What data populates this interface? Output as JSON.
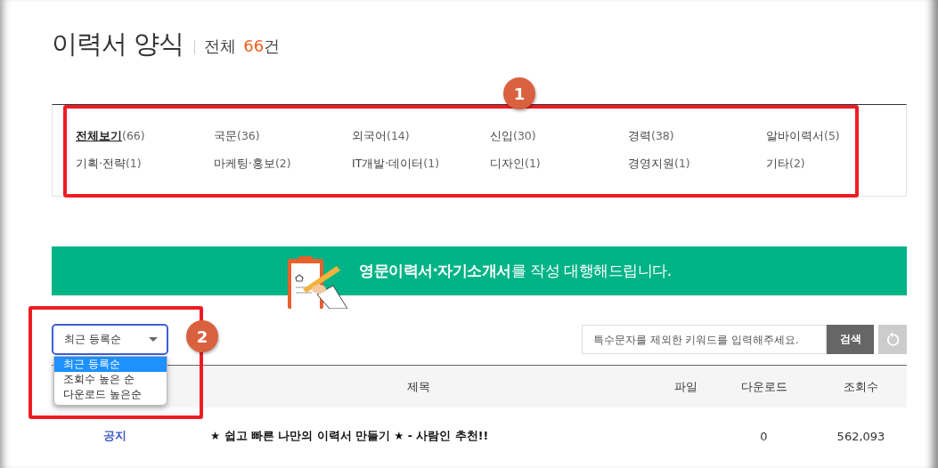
{
  "header": {
    "title": "이력서 양식",
    "total_label": "전체",
    "total_count": "66",
    "total_unit": "건"
  },
  "category_panel": {
    "callout": "1",
    "items": [
      {
        "label": "전체보기",
        "count": "(66)",
        "selected": true
      },
      {
        "label": "국문",
        "count": "(36)",
        "selected": false
      },
      {
        "label": "외국어",
        "count": "(14)",
        "selected": false
      },
      {
        "label": "신입",
        "count": "(30)",
        "selected": false
      },
      {
        "label": "경력",
        "count": "(38)",
        "selected": false
      },
      {
        "label": "알바이력서",
        "count": "(5)",
        "selected": false
      },
      {
        "label": "기획·전략",
        "count": "(1)",
        "selected": false
      },
      {
        "label": "마케팅·홍보",
        "count": "(2)",
        "selected": false
      },
      {
        "label": "IT개발·데이터",
        "count": "(1)",
        "selected": false
      },
      {
        "label": "디자인",
        "count": "(1)",
        "selected": false
      },
      {
        "label": "경영지원",
        "count": "(1)",
        "selected": false
      },
      {
        "label": "기타",
        "count": "(2)",
        "selected": false
      }
    ]
  },
  "banner": {
    "text": "**영문이력서·자기소개서**를 작성 대행해드립니다."
  },
  "sort": {
    "callout": "2",
    "value": "최근 등록순",
    "expanded": true,
    "options": [
      {
        "label": "최근 등록순",
        "selected": true
      },
      {
        "label": "조회수 높은 순",
        "selected": false
      },
      {
        "label": "다운로드 높은순",
        "selected": false
      }
    ]
  },
  "search": {
    "placeholder": "특수문자를 제외한 키워드를 입력해주세요.",
    "button": "검색"
  },
  "table": {
    "columns": [
      "제목",
      "파일",
      "다운로드",
      "조회수"
    ],
    "rows": [
      {
        "type": "공지",
        "title": "★ 쉽고 빠른 나만의 이력서 만들기 ★ - 사람인 추천!!",
        "downloads": "0",
        "views": "562,093"
      }
    ]
  }
}
